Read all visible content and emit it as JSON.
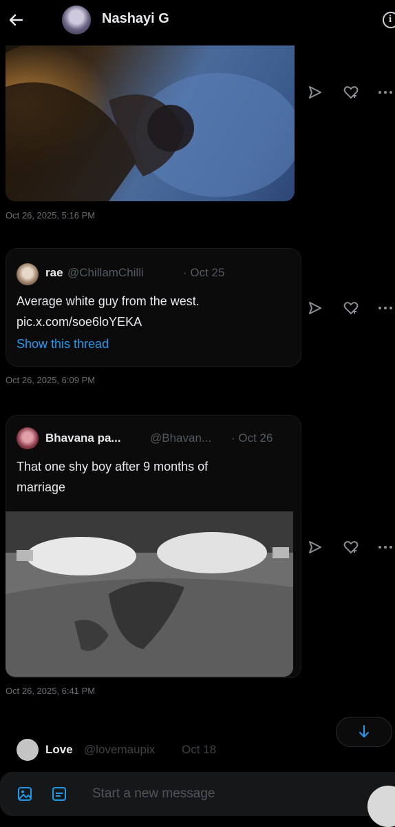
{
  "header": {
    "title": "Nashayi G"
  },
  "messages": [
    {
      "timestamp": "Oct 26, 2025, 5:16 PM"
    },
    {
      "quote": {
        "name": "rae",
        "handle": "@ChillamChilli",
        "date": "· Oct 25",
        "text_line1": "Average white guy from the west.",
        "text_line2": "pic.x.com/soe6loYEKA",
        "show_thread": "Show this thread"
      },
      "timestamp": "Oct 26, 2025, 6:09 PM"
    },
    {
      "quote": {
        "name": "Bhavana pa...",
        "handle": "@Bhavan...",
        "date": "· Oct 26",
        "text_line1": "That one shy boy after 9 months of",
        "text_line2": "marriage"
      },
      "timestamp": "Oct 26, 2025, 6:41 PM"
    },
    {
      "quote": {
        "name": "Love",
        "handle": "@lovemaupix",
        "date": "Oct 18"
      }
    }
  ],
  "composer": {
    "placeholder": "Start a new message"
  },
  "colors": {
    "background": "#000000",
    "accent": "#1d9bf0",
    "muted_text": "#6b6f73"
  },
  "icons": [
    "back-arrow-icon",
    "info-icon",
    "share-icon",
    "react-heart-icon",
    "more-icon",
    "scroll-down-icon",
    "image-icon",
    "gif-icon"
  ]
}
